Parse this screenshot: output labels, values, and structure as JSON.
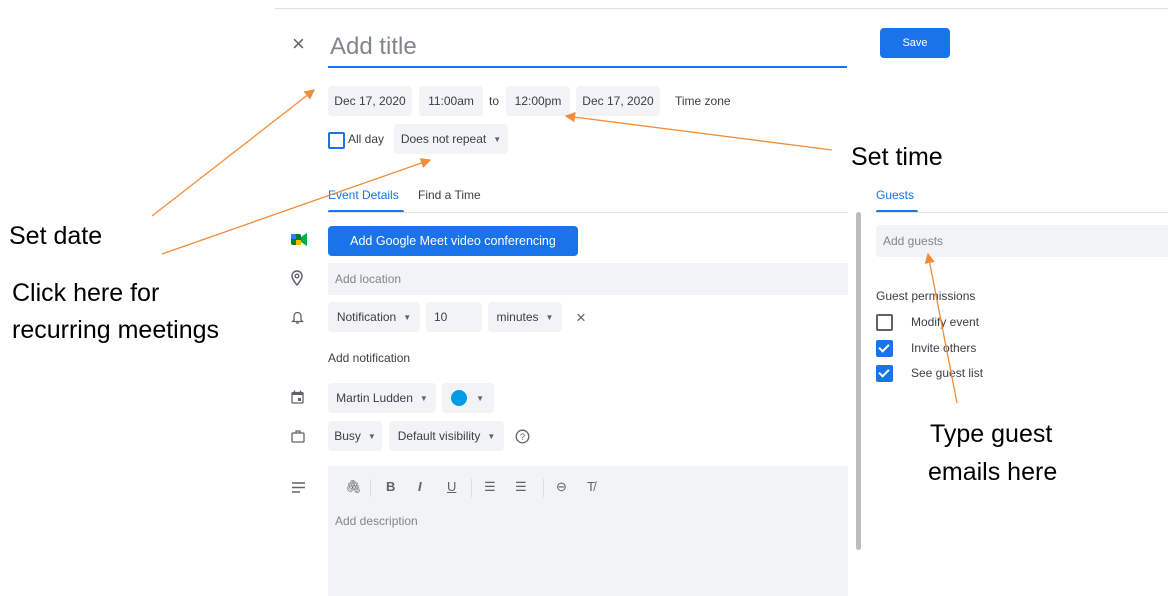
{
  "header": {
    "close_glyph": "×",
    "title_placeholder": "Add title",
    "save_label": "Save"
  },
  "datetime": {
    "start_date": "Dec 17, 2020",
    "start_time": "11:00am",
    "to_label": "to",
    "end_time": "12:00pm",
    "end_date": "Dec 17, 2020",
    "timezone_label": "Time zone",
    "all_day_label": "All day",
    "all_day_checked": false,
    "repeat_label": "Does not repeat"
  },
  "tabs": {
    "event_details": "Event Details",
    "find_time": "Find a Time"
  },
  "details": {
    "meet_button": "Add Google Meet video conferencing",
    "location_placeholder": "Add location",
    "notification_type": "Notification",
    "notification_value": "10",
    "notification_unit": "minutes",
    "add_notification": "Add notification",
    "calendar_owner": "Martin Ludden",
    "calendar_color": "#039be5",
    "busy_status": "Busy",
    "visibility": "Default visibility",
    "description_placeholder": "Add description"
  },
  "guests": {
    "tab_label": "Guests",
    "add_placeholder": "Add guests",
    "permissions_title": "Guest permissions",
    "permissions": [
      {
        "label": "Modify event",
        "checked": false
      },
      {
        "label": "Invite others",
        "checked": true
      },
      {
        "label": "See guest list",
        "checked": true
      }
    ]
  },
  "annotations": {
    "set_date": "Set date",
    "recurring_line1": "Click here for",
    "recurring_line2": "recurring meetings",
    "set_time": "Set time",
    "guest_line1": "Type guest",
    "guest_line2": "emails here"
  },
  "colors": {
    "accent": "#1a73e8",
    "arrow": "#f28c38",
    "field_bg": "#f1f3f4"
  }
}
